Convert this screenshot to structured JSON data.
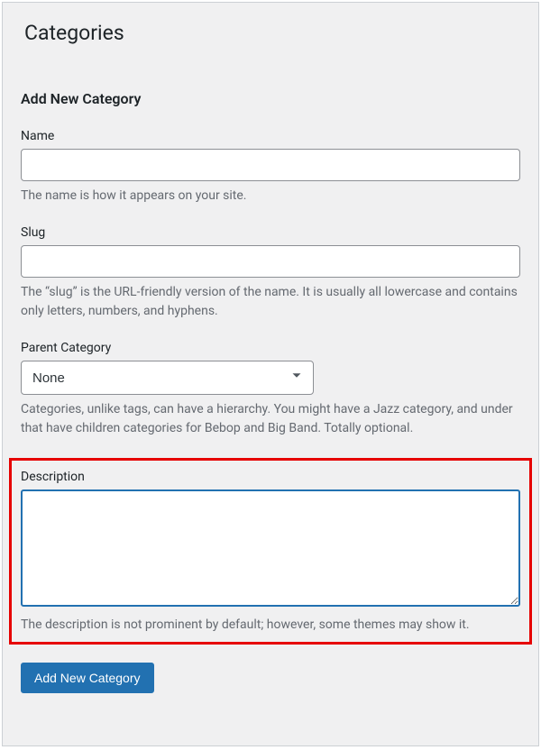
{
  "page": {
    "title": "Categories"
  },
  "form": {
    "heading": "Add New Category",
    "name": {
      "label": "Name",
      "value": "",
      "help": "The name is how it appears on your site."
    },
    "slug": {
      "label": "Slug",
      "value": "",
      "help": "The “slug” is the URL-friendly version of the name. It is usually all lowercase and contains only letters, numbers, and hyphens."
    },
    "parent": {
      "label": "Parent Category",
      "selected": "None",
      "help": "Categories, unlike tags, can have a hierarchy. You might have a Jazz category, and under that have children categories for Bebop and Big Band. Totally optional."
    },
    "description": {
      "label": "Description",
      "value": "",
      "help": "The description is not prominent by default; however, some themes may show it."
    },
    "submit": {
      "label": "Add New Category"
    }
  }
}
